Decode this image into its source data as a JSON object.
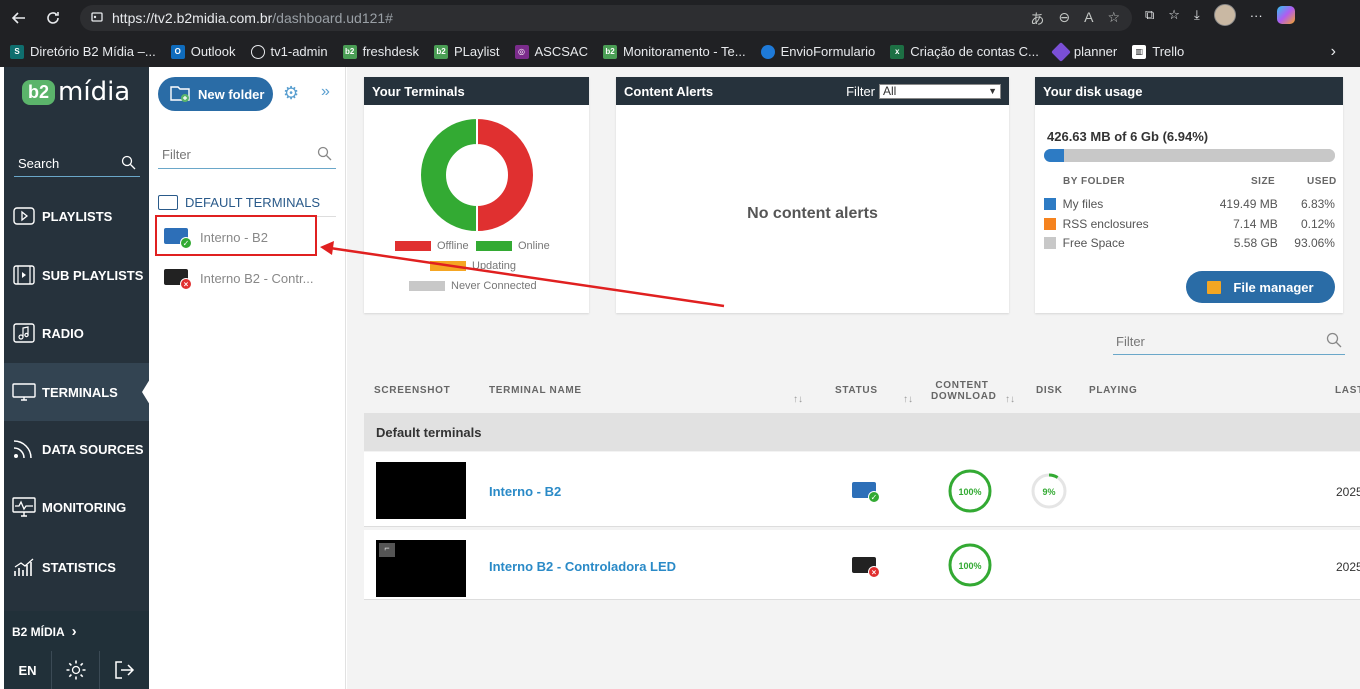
{
  "browser": {
    "url_host": "https://tv2.b2midia.com.br",
    "url_path": "/dashboard.ud121#",
    "bookmarks": [
      {
        "label": "Diretório B2 Mídia –...",
        "icon": "sharepoint-icon",
        "color": "#0f6e6e"
      },
      {
        "label": "Outlook",
        "icon": "outlook-icon",
        "color": "#0f6cbd"
      },
      {
        "label": "tv1-admin",
        "icon": "globe-icon",
        "color": "#555555"
      },
      {
        "label": "freshdesk",
        "icon": "b2-icon",
        "color": "#4a9e55"
      },
      {
        "label": "PLaylist",
        "icon": "b2-icon",
        "color": "#4a9e55"
      },
      {
        "label": "ASCSAC",
        "icon": "ascsac-icon",
        "color": "#7b2c8c"
      },
      {
        "label": "Monitoramento - Te...",
        "icon": "b2-icon",
        "color": "#4a9e55"
      },
      {
        "label": "EnvioFormulario",
        "icon": "onedrive-icon",
        "color": "#1e7ad8"
      },
      {
        "label": "Criação de contas C...",
        "icon": "excel-icon",
        "color": "#1d7044"
      },
      {
        "label": "planner",
        "icon": "planner-icon",
        "color": "#7a4fd6"
      },
      {
        "label": "Trello",
        "icon": "trello-icon",
        "color": "#ffffff"
      }
    ]
  },
  "sidebar": {
    "logo_badge": "b2",
    "logo_text": "mídia",
    "search_label": "Search",
    "items": [
      {
        "label": "PLAYLISTS",
        "icon": "play-icon"
      },
      {
        "label": "SUB PLAYLISTS",
        "icon": "film-icon"
      },
      {
        "label": "RADIO",
        "icon": "music-icon"
      },
      {
        "label": "TERMINALS",
        "icon": "monitor-icon"
      },
      {
        "label": "DATA SOURCES",
        "icon": "rss-icon"
      },
      {
        "label": "MONITORING",
        "icon": "monitoring-icon"
      },
      {
        "label": "STATISTICS",
        "icon": "chart-icon"
      }
    ],
    "active": "TERMINALS",
    "org_label": "B2 MÍDIA",
    "language": "EN"
  },
  "folders": {
    "new_folder_label": "New folder",
    "filter_placeholder": "Filter",
    "default_folder_label": "DEFAULT TERMINALS",
    "terminals": [
      {
        "name": "Interno - B2",
        "status": "online"
      },
      {
        "name": "Interno B2 - Contr...",
        "status": "offline"
      }
    ]
  },
  "your_terminals": {
    "title": "Your Terminals",
    "online_fraction": 0.5,
    "offline_fraction": 0.5,
    "legend": {
      "offline": "Offline",
      "online": "Online",
      "updating": "Updating",
      "never": "Never Connected"
    },
    "colors": {
      "offline": "#e03030",
      "online": "#33aa33",
      "updating": "#f5a623",
      "never": "#c8c8c8"
    }
  },
  "content_alerts": {
    "title": "Content Alerts",
    "filter_label": "Filter",
    "filter_value": "All",
    "empty_text": "No content alerts"
  },
  "disk": {
    "title": "Your disk usage",
    "total": "426.63 MB of 6 Gb (6.94%)",
    "header_folder": "BY FOLDER",
    "header_size": "SIZE",
    "header_used": "USED",
    "rows": [
      {
        "name": "My files",
        "size": "419.49 MB",
        "used": "6.83%",
        "color": "#2d7bc4",
        "fraction": 0.0683
      },
      {
        "name": "RSS enclosures",
        "size": "7.14 MB",
        "used": "0.12%",
        "color": "#f5831f",
        "fraction": 0.0012
      },
      {
        "name": "Free Space",
        "size": "5.58 GB",
        "used": "93.06%",
        "color": "#c8c8c8",
        "fraction": 0.9306
      }
    ],
    "file_manager_label": "File manager"
  },
  "table": {
    "filter_placeholder": "Filter",
    "headers": {
      "screenshot": "SCREENSHOT",
      "name": "TERMINAL NAME",
      "status": "STATUS",
      "content_1": "CONTENT",
      "content_2": "DOWNLOAD",
      "disk": "DISK",
      "playing": "PLAYING",
      "last": "LAST"
    },
    "group": "Default terminals",
    "rows": [
      {
        "name": "Interno - B2",
        "status": "online",
        "content": "100%",
        "content_fraction": 1.0,
        "disk": "9%",
        "disk_fraction": 0.09,
        "last": "2025"
      },
      {
        "name": "Interno B2 - Controladora LED",
        "status": "offline",
        "content": "100%",
        "content_fraction": 1.0,
        "disk": "",
        "disk_fraction": 0,
        "last": "2025"
      }
    ]
  }
}
